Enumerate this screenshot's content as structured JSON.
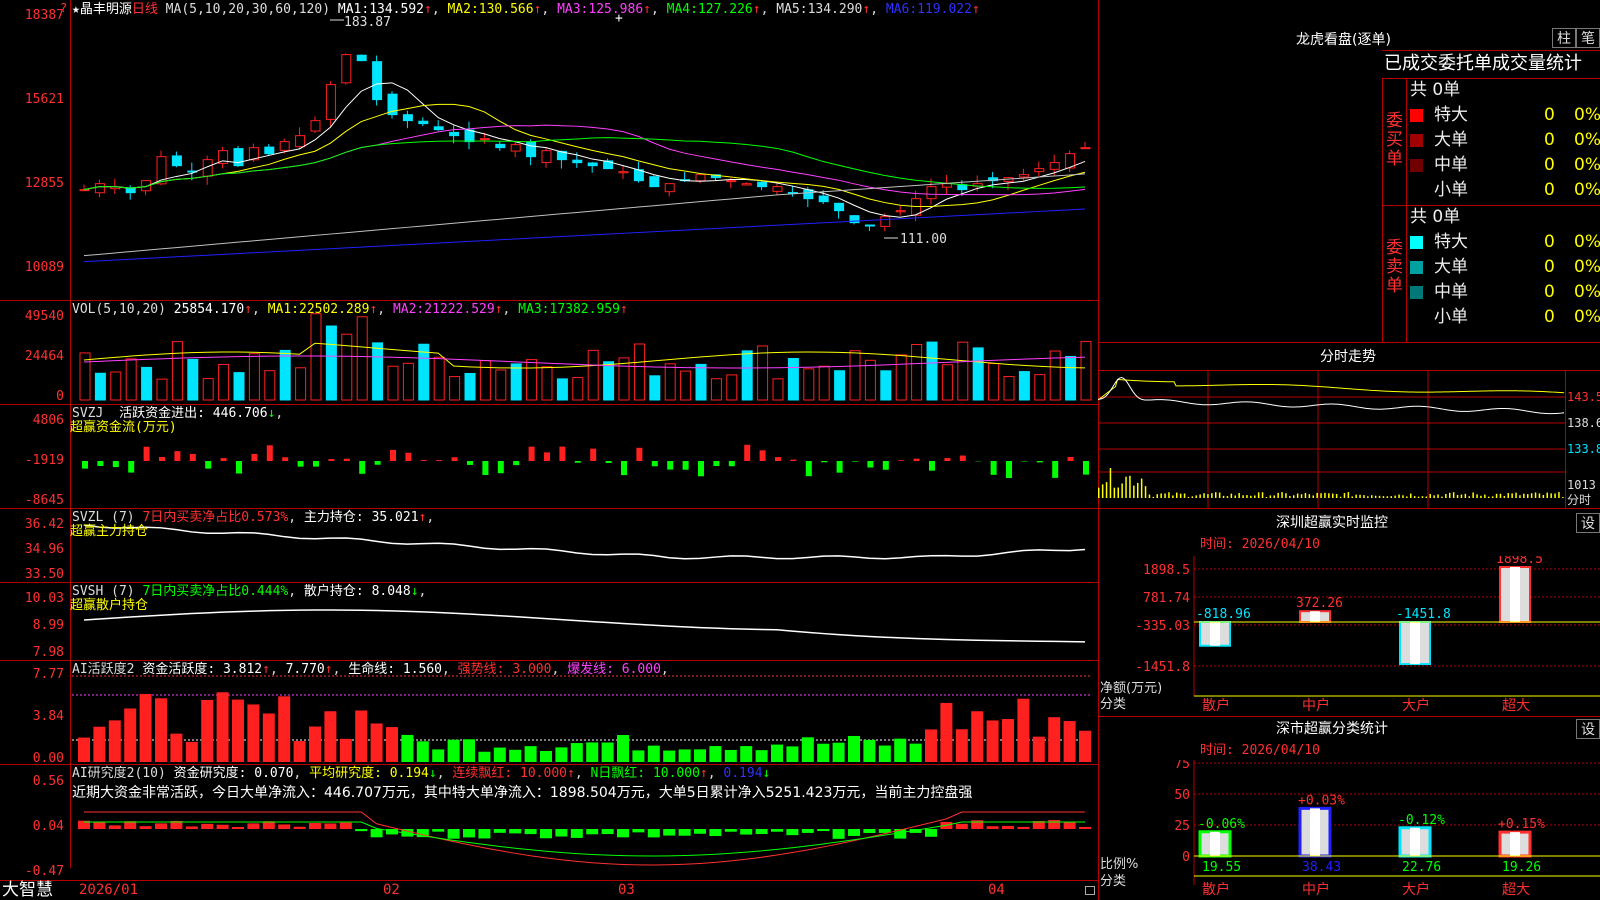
{
  "colors": {
    "up": "#ff2020",
    "down": "#00e5ff",
    "ma1": "#ffffff",
    "ma2": "#ffff00",
    "ma3": "#ff40ff",
    "ma4": "#00ff00",
    "ma5": "#c0c0c0",
    "ma6": "#2020ff",
    "grid": "#b40000"
  },
  "top_flag": "?",
  "main": {
    "stock_name": "★晶丰明源",
    "period": "日线",
    "ma_title": "MA(5,10,20,30,60,120)",
    "ma": [
      {
        "label": "MA1:",
        "value": "134.592"
      },
      {
        "label": "MA2:",
        "value": "130.566"
      },
      {
        "label": "MA3:",
        "value": "125.986"
      },
      {
        "label": "MA4:",
        "value": "127.226"
      },
      {
        "label": "MA5:",
        "value": "134.290"
      },
      {
        "label": "MA6:",
        "value": "119.022"
      }
    ],
    "up_arrow": "↑",
    "down_arrow": "↓",
    "yticks": [
      "18387",
      "15621",
      "12855",
      "10089"
    ],
    "high_label": "183.87",
    "low_label": "111.00",
    "cross": "+"
  },
  "vol": {
    "title": "VOL(5,10,20)",
    "value": "25854.170",
    "ma1": "22502.289",
    "ma2": "21222.529",
    "ma3": "17382.959",
    "ma1_label": "MA1:",
    "ma2_label": "MA2:",
    "ma3_label": "MA3:",
    "yticks": [
      "49540",
      "24464",
      "0"
    ]
  },
  "svzj": {
    "title": "SVZJ",
    "sub": "活跃资金进出:",
    "value": "446.706",
    "label2": "超赢资金流(万元)",
    "yticks": [
      "4806",
      "-1919",
      "-8645"
    ]
  },
  "svzl": {
    "title": "SVZL (7)",
    "sub": "7日内买卖净占比0.573%",
    "hold": "主力持仓:",
    "hold_value": "35.021",
    "label2": "超赢主力持仓",
    "yticks": [
      "36.42",
      "34.96",
      "33.50"
    ]
  },
  "svsh": {
    "title": "SVSH (7)",
    "sub": "7日内买卖净占比0.444%",
    "hold": "散户持仓:",
    "hold_value": "8.048",
    "label2": "超赢散户持仓",
    "yticks": [
      "10.03",
      "8.99",
      "7.98"
    ]
  },
  "ai1": {
    "title": "AI活跃度2",
    "sub": "资金活跃度:",
    "v1": "3.812",
    "v2": "7.770",
    "life": "生命线:",
    "v3": "1.560",
    "strong": "强势线:",
    "v4": "3.000",
    "burst": "爆发线:",
    "v5": "6.000",
    "yticks": [
      "7.77",
      "3.84",
      "0.00"
    ]
  },
  "ai2": {
    "title": "AI研究度2(10)",
    "sub": "资金研究度:",
    "v1": "0.070",
    "avg": "平均研究度:",
    "v2": "0.194",
    "lx": "连续飘红:",
    "v3": "10.000",
    "nd": "N日飘红:",
    "v4": "10.000",
    "v5": "0.194",
    "comment": "近期大资金非常活跃，今日大单净流入：446.707万元，其中特大单净流入：1898.504万元，大单5日累计净入5251.423万元，当前主力控盘强",
    "yticks": [
      "0.56",
      "0.04",
      "-0.47"
    ]
  },
  "xaxis": {
    "brand": "大智慧",
    "labels": [
      "2026/01",
      "02",
      "03",
      "04"
    ]
  },
  "lhb": {
    "title": "龙虎看盘(逐单)",
    "btn1": "柱",
    "btn2": "笔",
    "subtitle": "已成交委托单成交量统计",
    "buy": {
      "side": "委买单",
      "total": "共 0单",
      "rows": [
        {
          "name": "特大",
          "v": "0",
          "p": "0%",
          "c": "#ff0000"
        },
        {
          "name": "大单",
          "v": "0",
          "p": "0%",
          "c": "#a00000"
        },
        {
          "name": "中单",
          "v": "0",
          "p": "0%",
          "c": "#700000"
        },
        {
          "name": "小单",
          "v": "0",
          "p": "0%",
          "c": "#000000"
        }
      ]
    },
    "sell": {
      "side": "委卖单",
      "total": "共 0单",
      "rows": [
        {
          "name": "特大",
          "v": "0",
          "p": "0%",
          "c": "#00ffff"
        },
        {
          "name": "大单",
          "v": "0",
          "p": "0%",
          "c": "#00a0a0"
        },
        {
          "name": "中单",
          "v": "0",
          "p": "0%",
          "c": "#007878"
        },
        {
          "name": "小单",
          "v": "0",
          "p": "0%",
          "c": "#000000"
        }
      ]
    }
  },
  "fst": {
    "title": "分时走势",
    "yticks": [
      "143.5",
      "138.6",
      "133.8"
    ],
    "vol_label": "1013",
    "unit": "分时"
  },
  "szmon": {
    "title": "深圳超赢实时监控",
    "btn": "设",
    "time": "时间: 2026/04/10",
    "yticks": [
      "1898.5",
      "781.74",
      "-335.03",
      "-1451.8"
    ],
    "net_label": "净额(万元)",
    "cat_label": "分类",
    "cats": [
      "散户",
      "中户",
      "大户",
      "超大"
    ],
    "vals": [
      "-818.96",
      "372.26",
      "-1451.8",
      "1898.5"
    ]
  },
  "szcls": {
    "title": "深市超赢分类统计",
    "btn": "设",
    "time": "时间: 2026/04/10",
    "yticks": [
      "75",
      "50",
      "25",
      "0"
    ],
    "ratio_label": "比例%",
    "cat_label": "分类",
    "cats": [
      "散户",
      "中户",
      "大户",
      "超大"
    ],
    "pct": [
      "19.55",
      "38.43",
      "22.76",
      "19.26"
    ],
    "chg": [
      "-0.06%",
      "+0.03%",
      "-0.12%",
      "+0.15%"
    ]
  },
  "chart_data": [
    {
      "type": "candlestick",
      "title": "晶丰明源 日线",
      "ylim": [
        10089,
        18387
      ],
      "high": 183.87,
      "low": 111.0
    },
    {
      "type": "bar",
      "title": "深圳超赢实时监控",
      "categories": [
        "散户",
        "中户",
        "大户",
        "超大"
      ],
      "values": [
        -818.96,
        372.26,
        -1451.8,
        1898.5
      ],
      "ylim": [
        -1451.8,
        1898.5
      ]
    },
    {
      "type": "bar",
      "title": "深市超赢分类统计",
      "categories": [
        "散户",
        "中户",
        "大户",
        "超大"
      ],
      "values": [
        19.55,
        38.43,
        22.76,
        19.26
      ],
      "ylim": [
        0,
        75
      ]
    }
  ]
}
